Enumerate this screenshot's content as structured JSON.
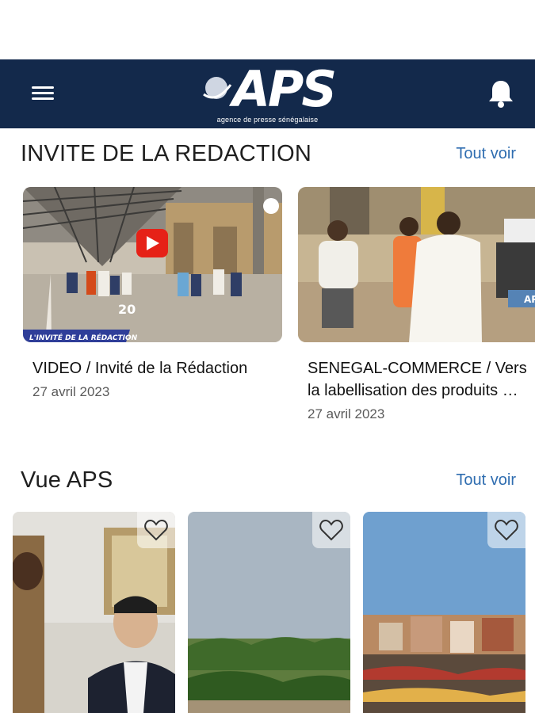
{
  "header": {
    "logo_text": "APS",
    "logo_subtitle": "agence de presse sénégalaise"
  },
  "sections": {
    "invite": {
      "title": "INVITE DE LA REDACTION",
      "see_all": "Tout voir",
      "cards": [
        {
          "title": "VIDEO / Invité de la Rédaction",
          "date": "27 avril 2023",
          "banner": "L'INVITÉ DE LA RÉDACTION",
          "floor_text": "20"
        },
        {
          "title": "SENEGAL-COMMERCE / Vers la labellisation des produits …",
          "date": "27 avril 2023",
          "badge": "AP"
        }
      ]
    },
    "vue_aps": {
      "title": "Vue APS",
      "see_all": "Tout voir"
    }
  },
  "colors": {
    "header_bg": "#13294b",
    "link": "#2f6db0",
    "play_red": "#e62117"
  }
}
